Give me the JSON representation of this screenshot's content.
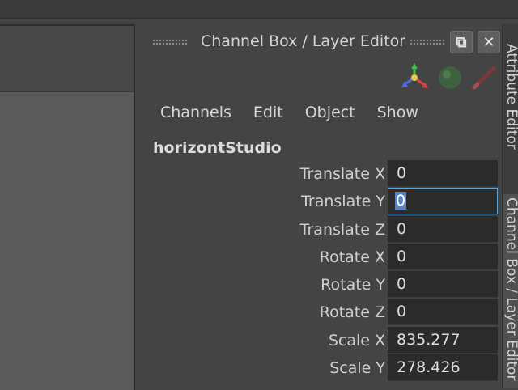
{
  "panel": {
    "title": "Channel Box / Layer Editor"
  },
  "window_buttons": {
    "float_glyph": "⧉",
    "close_glyph": "✕"
  },
  "icons": [
    "axis-icon",
    "sphere-icon",
    "pen-icon"
  ],
  "menu": {
    "items": [
      "Channels",
      "Edit",
      "Object",
      "Show"
    ]
  },
  "object": {
    "name": "horizontStudio"
  },
  "attributes": [
    {
      "label": "Translate X",
      "value": "0"
    },
    {
      "label": "Translate Y",
      "value": "0"
    },
    {
      "label": "Translate Z",
      "value": "0"
    },
    {
      "label": "Rotate X",
      "value": "0"
    },
    {
      "label": "Rotate Y",
      "value": "0"
    },
    {
      "label": "Rotate Z",
      "value": "0"
    },
    {
      "label": "Scale X",
      "value": "835.277"
    },
    {
      "label": "Scale Y",
      "value": "278.426"
    }
  ],
  "side_tabs": {
    "attribute_editor": "Attribute Editor",
    "channel_box": "Channel Box / Layer Editor"
  },
  "colors": {
    "background": "#444444",
    "field_background": "#2b2b2b",
    "focus_border": "#5da5d8",
    "selection": "#5c84c2"
  }
}
